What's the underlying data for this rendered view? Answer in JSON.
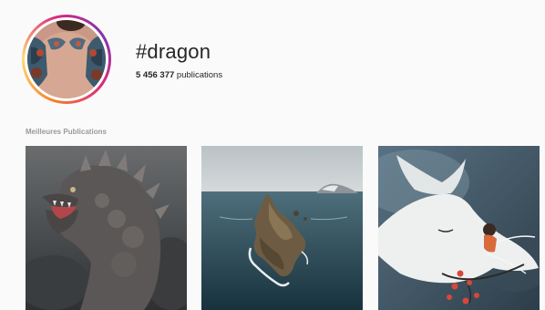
{
  "hashtag": {
    "title": "#dragon",
    "count": "5 456 377",
    "count_suffix": " publications"
  },
  "section": {
    "top_posts_label": "Meilleures Publications"
  },
  "posts": [
    {
      "icon": "dragon-statue-image"
    },
    {
      "icon": "island-aerial-image"
    },
    {
      "icon": "white-dragon-illustration-image"
    }
  ]
}
